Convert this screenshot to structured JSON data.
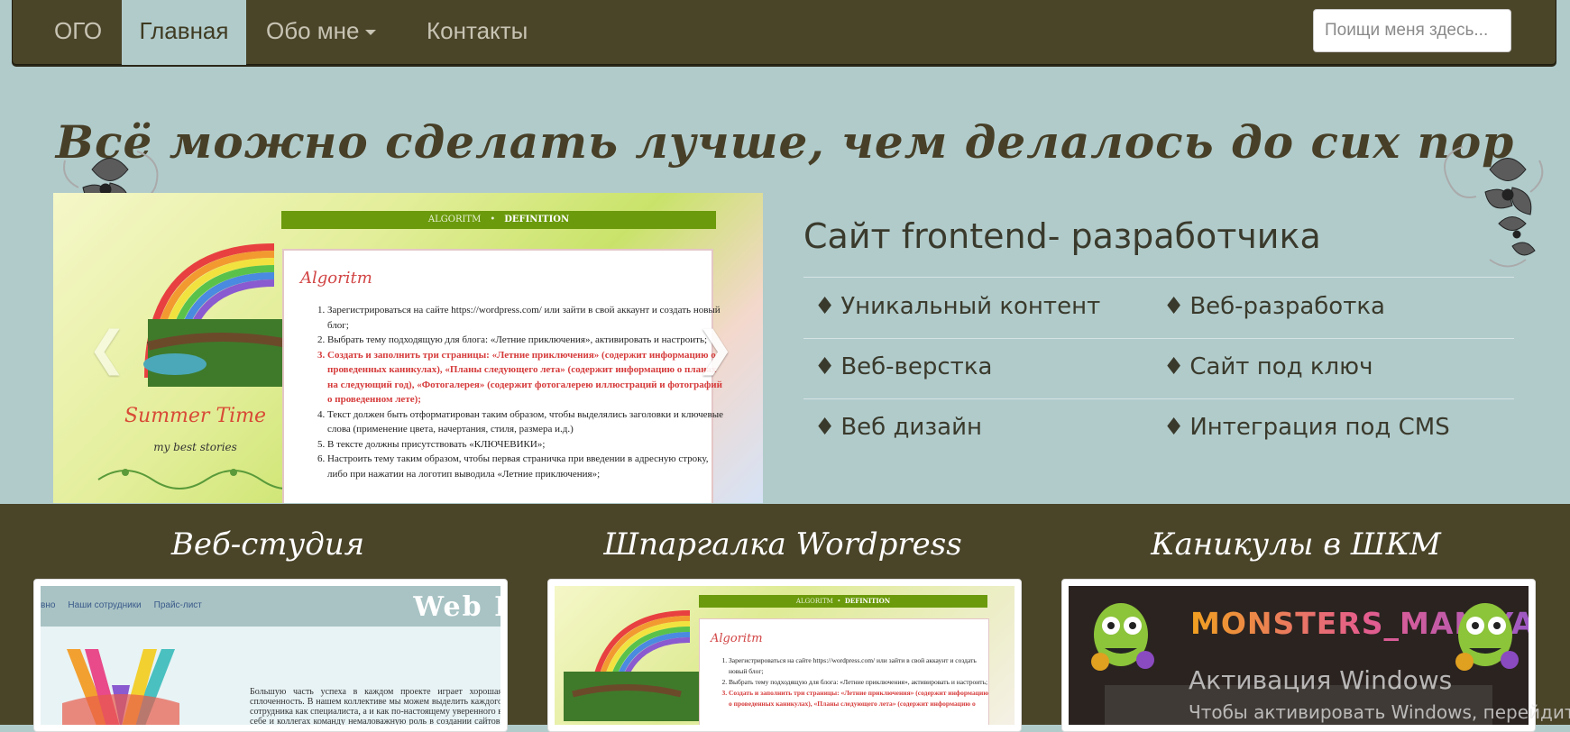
{
  "nav": {
    "brand": "ОГО",
    "home": "Главная",
    "about": "Обо мне",
    "contacts": "Контакты",
    "search_placeholder": "Поищи меня здесь..."
  },
  "hero": {
    "title": "Всё можно сделать лучше, чем делалось до сих пор"
  },
  "slider": {
    "nav_left": "ALGORITM",
    "nav_right": "DEFINITION",
    "doc_heading": "Algoritm",
    "items": [
      "Зарегистрироваться на сайте https://wordpress.com/ или зайти в свой аккаунт и создать новый блог;",
      "Выбрать тему подходящую для блога: «Летние приключения», активировать и настроить;",
      "Создать и заполнить три страницы: «Летние приключения» (содержит информацию о проведенных каникулах), «Планы следующего лета» (содержит информацию о планах на следующий год), «Фотогалерея» (содержит фотогалерею иллюстраций и фотографий о проведенном лете);",
      "Текст должен быть отформатирован таким образом, чтобы выделялись заголовки и ключевые слова (применение цвета, начертания, стиля, размера и.д.)",
      "В тексте должны присутствовать «КЛЮЧЕВИКИ»;",
      "Настроить тему таким образом, чтобы первая страничка при введении в адресную строку, либо при нажатии на логотип выводила «Летние приключения»;"
    ],
    "summer_title": "Summer Time",
    "summer_sub": "my best stories",
    "prev_arrow": "❮",
    "next_arrow": "❯"
  },
  "features": {
    "title": "Сайт frontend- разработчика",
    "diamond": "♦",
    "left": [
      "Уникальный контент",
      "Веб-верстка",
      "Веб дизайн"
    ],
    "right": [
      "Веб-разработка",
      "Сайт под ключ",
      "Интеграция под CMS"
    ]
  },
  "cards": [
    {
      "title": "Веб-студия",
      "menu": [
        "вно",
        "Наши сотрудники",
        "Прайс-лист"
      ],
      "brand": "Web R",
      "text": "Большую часть успеха в каждом проекте играет хорошая сплоченность. В нашем коллективе мы можем выделить каждого сотрудника как специалиста, а и как по-настоящему уверенного в себе и коллегах команду немаловажную роль в создании сайтов, а коллективной работе веб-студии"
    },
    {
      "title": "Шпаргалка Wordpress",
      "nav_left": "ALGORITM",
      "nav_right": "DEFINITION",
      "doc_heading": "Algoritm",
      "items": [
        "Зарегистрироваться на сайте https://wordpress.com/ или зайти в свой аккаунт и создать новый блог;",
        "Выбрать тему подходящую для блога: «Летние приключения», активировать и настроить;",
        "Создать и заполнить три страницы: «Летние приключения» (содержит информацию о проведенных каникулах), «Планы следующего лета» (содержит информацию о"
      ]
    },
    {
      "title": "Каникулы в ШКМ",
      "banner": "MONSTERS_MANIYA"
    }
  ],
  "watermark": {
    "line1": "Активация Windows",
    "line2": "Чтобы активировать Windows, перейдите"
  }
}
